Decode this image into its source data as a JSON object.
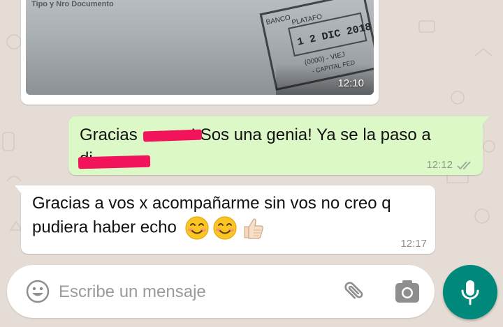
{
  "colors": {
    "wallpaper": "#e5ddd5",
    "outgoing_bubble": "#dcf8c6",
    "incoming_bubble": "#ffffff",
    "mic_button": "#00897b"
  },
  "messages": {
    "image": {
      "photo_caption_text": "Tipo y Nro Documento",
      "stamp_lines": [
        "BANCO",
        "PLATAFO",
        "1 2 DIC 2018",
        "(0000) - VIEJ",
        "- CAPITAL FED"
      ],
      "time": "12:10"
    },
    "outgoing": {
      "text_part1": "Gracias ",
      "text_part2": "! Sos una genia! Ya se la paso a",
      "text_part3": "di",
      "time": "12:12",
      "status_icon": "double-check-icon"
    },
    "incoming": {
      "text": "Gracias a vos x acompañarme sin vos no creo q pudiera haber echo",
      "emojis": [
        "smiling-face-icon",
        "smiling-face-icon",
        "thumbs-up-icon"
      ],
      "time": "12:17"
    }
  },
  "composer": {
    "placeholder": "Escribe un mensaje",
    "emoji_icon": "emoji-icon",
    "attach_icon": "paperclip-icon",
    "camera_icon": "camera-icon",
    "mic_icon": "microphone-icon"
  }
}
